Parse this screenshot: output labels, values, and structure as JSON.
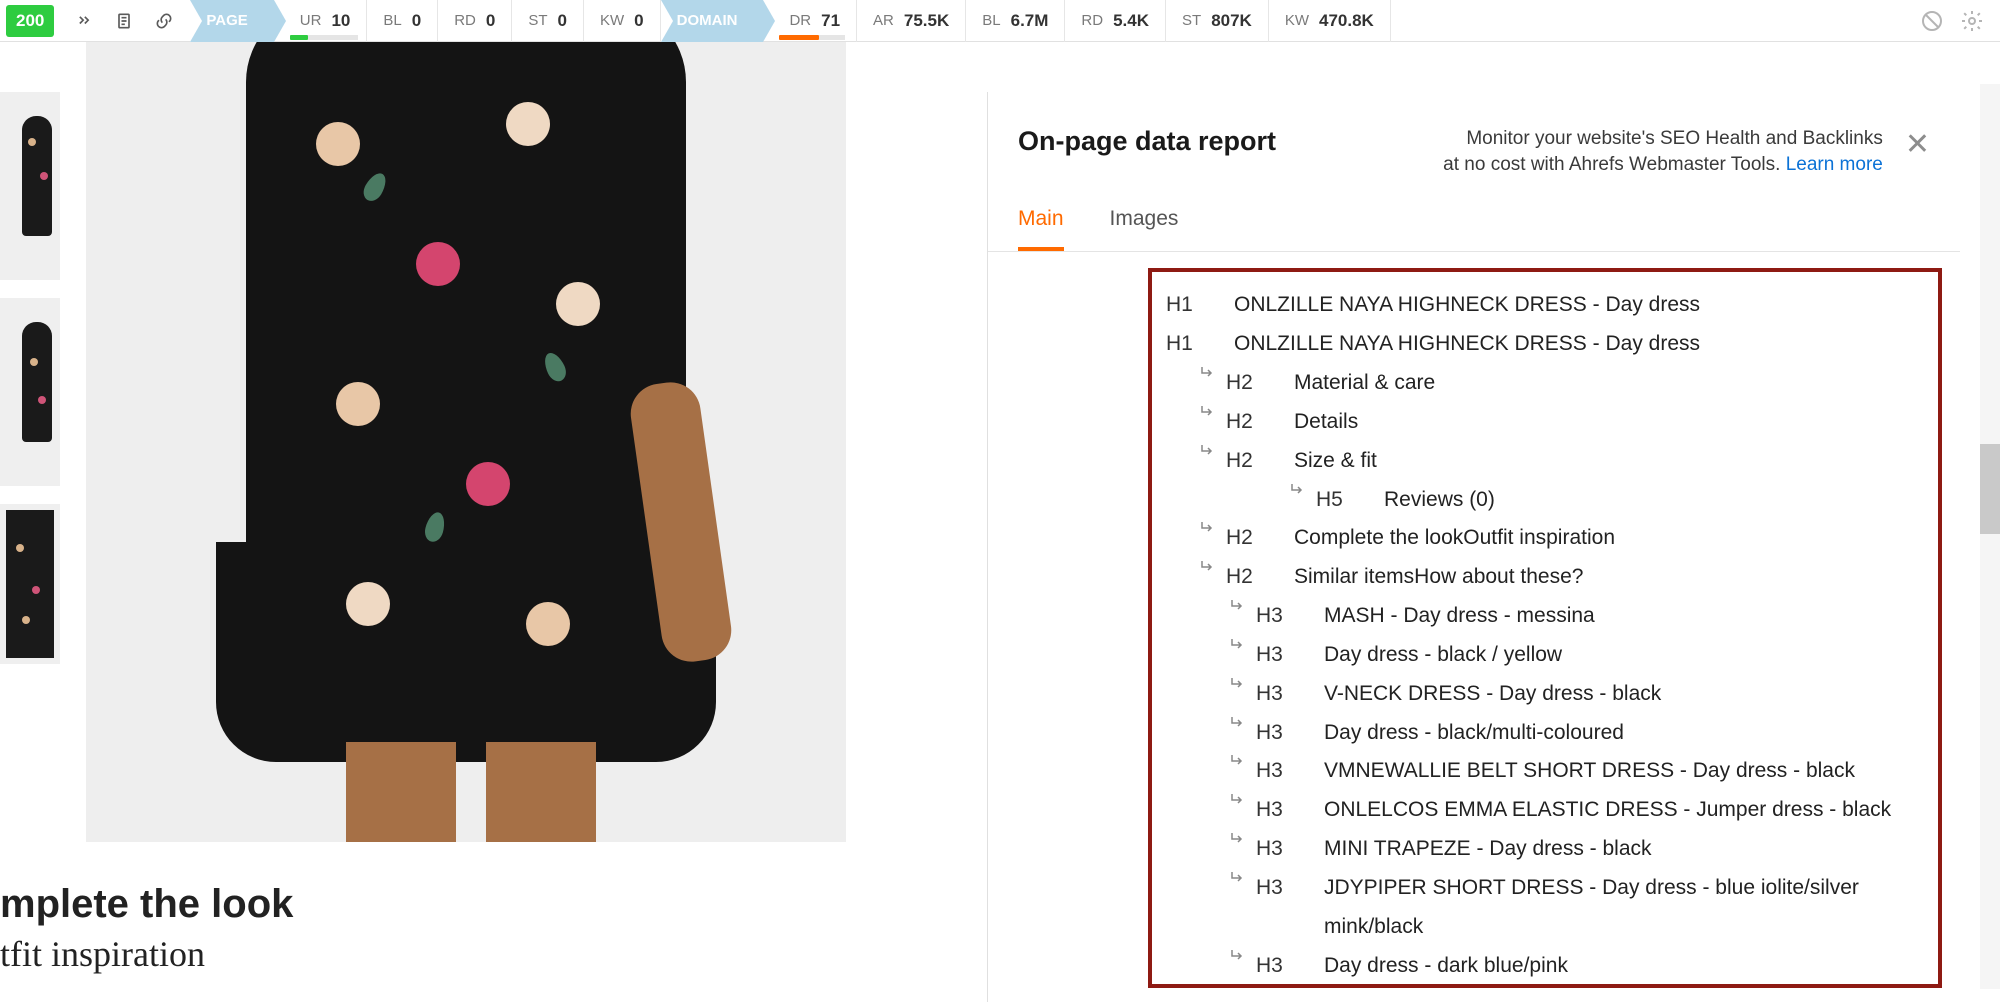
{
  "toolbar": {
    "status": "200",
    "page_tag": "PAGE",
    "domain_tag": "DOMAIN",
    "metrics": {
      "ur": {
        "label": "UR",
        "value": "10"
      },
      "bl_page": {
        "label": "BL",
        "value": "0"
      },
      "rd_page": {
        "label": "RD",
        "value": "0"
      },
      "st_page": {
        "label": "ST",
        "value": "0"
      },
      "kw_page": {
        "label": "KW",
        "value": "0"
      },
      "dr": {
        "label": "DR",
        "value": "71"
      },
      "ar": {
        "label": "AR",
        "value": "75.5K"
      },
      "bl_dom": {
        "label": "BL",
        "value": "6.7M"
      },
      "rd_dom": {
        "label": "RD",
        "value": "5.4K"
      },
      "st_dom": {
        "label": "ST",
        "value": "807K"
      },
      "kw_dom": {
        "label": "KW",
        "value": "470.8K"
      }
    }
  },
  "product": {
    "complete_look_heading": "mplete the look",
    "complete_look_sub": "tfit inspiration"
  },
  "panel": {
    "title": "On-page data report",
    "promo_line1": "Monitor your website's SEO Health and Backlinks",
    "promo_line2": "at no cost with Ahrefs Webmaster Tools. ",
    "promo_link": "Learn more",
    "tabs": {
      "main": "Main",
      "images": "Images"
    }
  },
  "headings": [
    {
      "level": "H1",
      "indent": 0,
      "arrow": false,
      "text": "ONLZILLE NAYA HIGHNECK DRESS - Day dress"
    },
    {
      "level": "H1",
      "indent": 0,
      "arrow": false,
      "text": "ONLZILLE NAYA HIGHNECK DRESS - Day dress"
    },
    {
      "level": "H2",
      "indent": 1,
      "arrow": true,
      "text": "Material & care"
    },
    {
      "level": "H2",
      "indent": 1,
      "arrow": true,
      "text": "Details"
    },
    {
      "level": "H2",
      "indent": 1,
      "arrow": true,
      "text": "Size & fit"
    },
    {
      "level": "H5",
      "indent": 3,
      "arrow": true,
      "text": "Reviews (0)"
    },
    {
      "level": "H2",
      "indent": 1,
      "arrow": true,
      "text": "Complete the lookOutfit inspiration"
    },
    {
      "level": "H2",
      "indent": 1,
      "arrow": true,
      "text": "Similar itemsHow about these?"
    },
    {
      "level": "H3",
      "indent": 2,
      "arrow": true,
      "text": "MASH - Day dress - messina"
    },
    {
      "level": "H3",
      "indent": 2,
      "arrow": true,
      "text": "Day dress - black / yellow"
    },
    {
      "level": "H3",
      "indent": 2,
      "arrow": true,
      "text": "V-NECK DRESS - Day dress - black"
    },
    {
      "level": "H3",
      "indent": 2,
      "arrow": true,
      "text": "Day dress - black/multi-coloured"
    },
    {
      "level": "H3",
      "indent": 2,
      "arrow": true,
      "text": "VMNEWALLIE BELT SHORT DRESS - Day dress - black"
    },
    {
      "level": "H3",
      "indent": 2,
      "arrow": true,
      "text": "ONLELCOS EMMA ELASTIC DRESS - Jumper dress - black"
    },
    {
      "level": "H3",
      "indent": 2,
      "arrow": true,
      "text": "MINI TRAPEZE - Day dress - black"
    },
    {
      "level": "H3",
      "indent": 2,
      "arrow": true,
      "text": "JDYPIPER SHORT DRESS - Day dress - blue iolite/silver mink/black"
    },
    {
      "level": "H3",
      "indent": 2,
      "arrow": true,
      "text": "Day dress - dark blue/pink"
    }
  ]
}
